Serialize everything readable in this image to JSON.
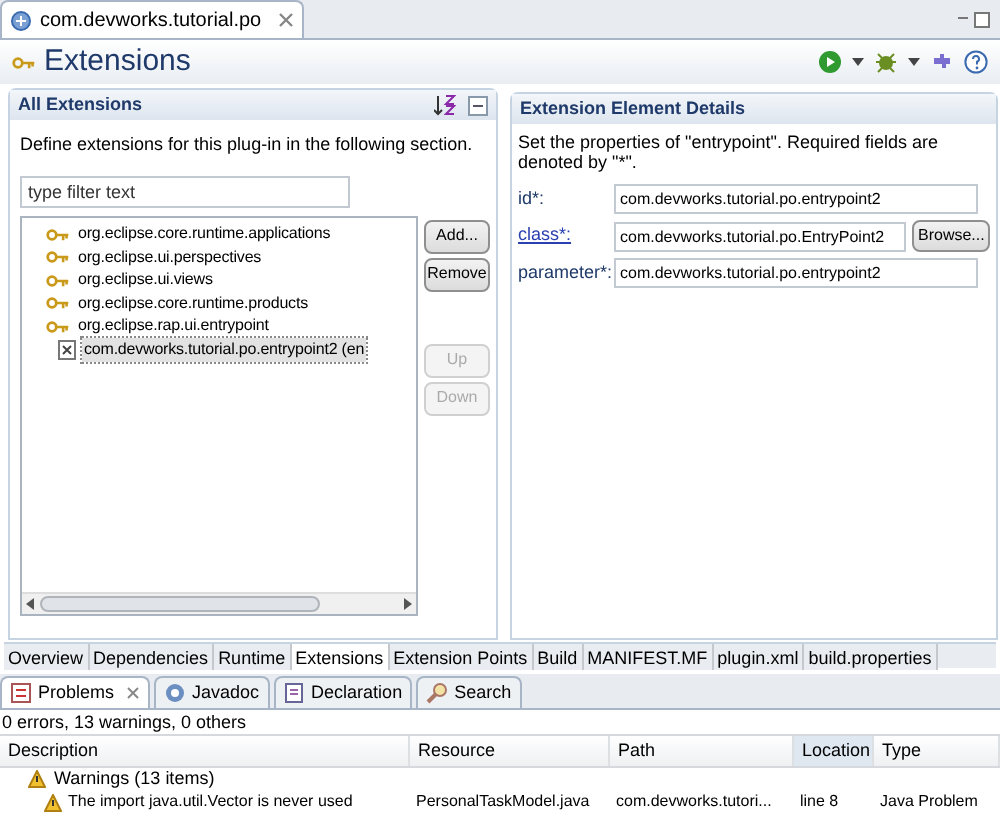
{
  "editor_tab": {
    "title": "com.devworks.tutorial.po"
  },
  "page_title": "Extensions",
  "all_extensions": {
    "title": "All Extensions",
    "description": "Define extensions for this plug-in in the following section.",
    "filter": {
      "placeholder": "type filter text"
    },
    "tree": [
      {
        "label": "org.eclipse.core.runtime.applications",
        "selected": false
      },
      {
        "label": "org.eclipse.ui.perspectives",
        "selected": false
      },
      {
        "label": "org.eclipse.ui.views",
        "selected": false
      },
      {
        "label": "org.eclipse.core.runtime.products",
        "selected": false
      },
      {
        "label": "org.eclipse.rap.ui.entrypoint",
        "selected": false,
        "children": [
          {
            "label": "com.devworks.tutorial.po.entrypoint2 (en",
            "selected": true
          }
        ]
      }
    ],
    "buttons": [
      {
        "label": "Add...",
        "disabled": false
      },
      {
        "label": "Remove",
        "disabled": false
      },
      {
        "label": "Up",
        "disabled": true
      },
      {
        "label": "Down",
        "disabled": true
      }
    ]
  },
  "details": {
    "title": "Extension Element Details",
    "description": "Set the properties of \"entrypoint\". Required fields are denoted by \"*\".",
    "fields": [
      {
        "label": "id*:",
        "value": "com.devworks.tutorial.po.entrypoint2",
        "kind": "text"
      },
      {
        "label": "class*:",
        "value": "com.devworks.tutorial.po.EntryPoint2",
        "kind": "link",
        "button": "Browse..."
      },
      {
        "label": "parameter*:",
        "value": "com.devworks.tutorial.po.entrypoint2",
        "kind": "text"
      }
    ]
  },
  "page_tabs": [
    {
      "label": "Overview",
      "selected": false
    },
    {
      "label": "Dependencies",
      "selected": false
    },
    {
      "label": "Runtime",
      "selected": false
    },
    {
      "label": "Extensions",
      "selected": true
    },
    {
      "label": "Extension Points",
      "selected": false
    },
    {
      "label": "Build",
      "selected": false
    },
    {
      "label": "MANIFEST.MF",
      "selected": false
    },
    {
      "label": "plugin.xml",
      "selected": false
    },
    {
      "label": "build.properties",
      "selected": false
    }
  ],
  "view_tabs": [
    {
      "label": "Problems",
      "selected": true
    },
    {
      "label": "Javadoc",
      "selected": false
    },
    {
      "label": "Declaration",
      "selected": false
    },
    {
      "label": "Search",
      "selected": false
    }
  ],
  "problems": {
    "summary": "0 errors, 13 warnings, 0 others",
    "columns": [
      {
        "label": "Description",
        "sorted": false
      },
      {
        "label": "Resource",
        "sorted": false
      },
      {
        "label": "Path",
        "sorted": false
      },
      {
        "label": "Location",
        "sorted": true
      },
      {
        "label": "Type",
        "sorted": false
      }
    ],
    "groups": [
      {
        "label": "Warnings (13 items)",
        "rows": [
          {
            "description": "The import java.util.Vector is never used",
            "resource": "PersonalTaskModel.java",
            "path": "com.devworks.tutori...",
            "location": "line 8",
            "type": "Java Problem"
          }
        ]
      }
    ]
  }
}
